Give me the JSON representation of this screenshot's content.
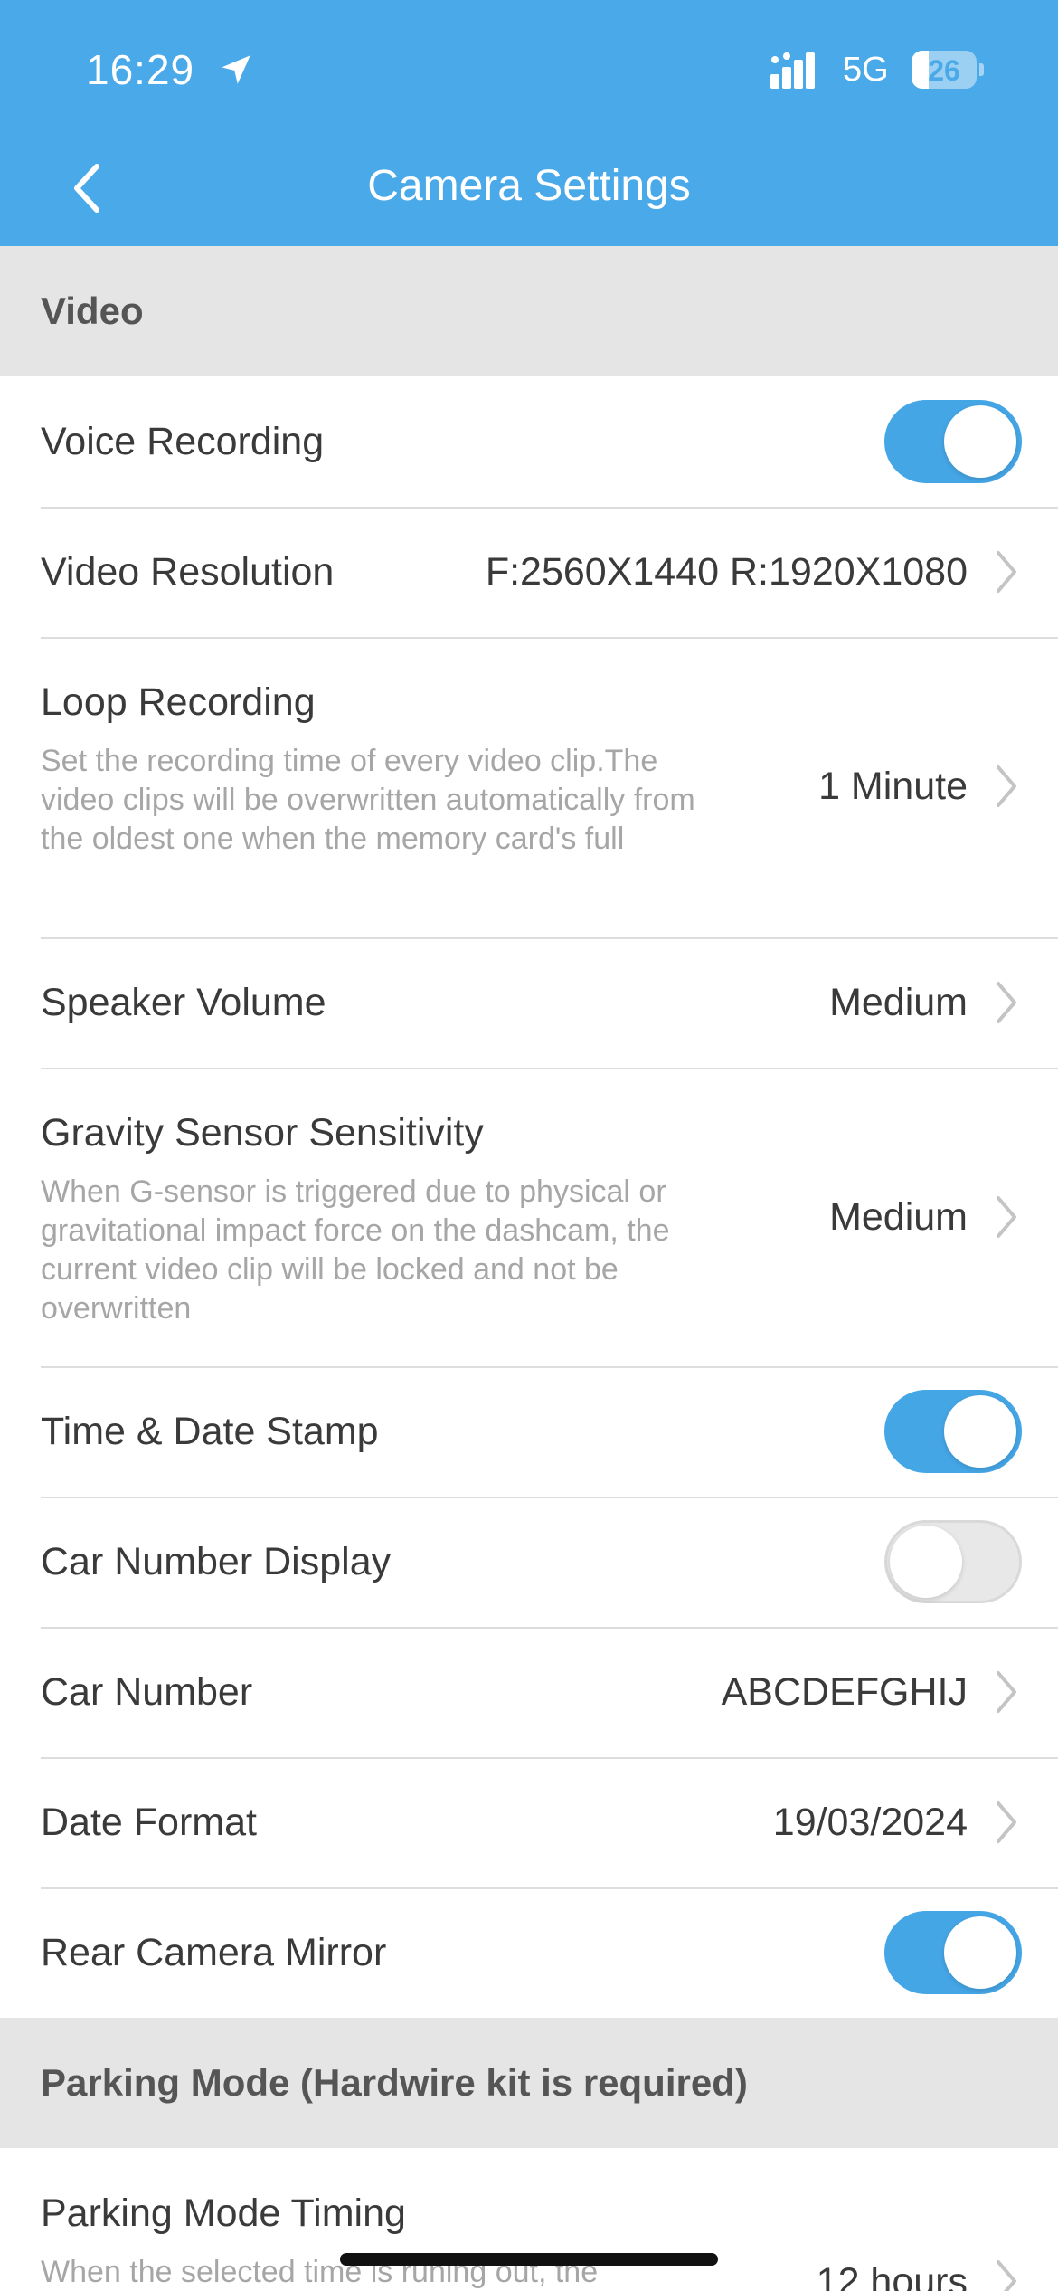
{
  "status_bar": {
    "time": "16:29",
    "network": "5G",
    "battery": "26",
    "battery_level_percent": 26,
    "location_icon": "location-arrow-icon",
    "signal_icon": "signal-bars-icon"
  },
  "nav": {
    "title": "Camera Settings",
    "back_icon": "chevron-left-icon"
  },
  "sections": {
    "video": "Video",
    "parking": "Parking Mode (Hardwire kit is required)"
  },
  "rows": {
    "voice_recording": {
      "label": "Voice Recording",
      "toggle_on": true
    },
    "video_resolution": {
      "label": "Video Resolution",
      "value": "F:2560X1440 R:1920X1080"
    },
    "loop_recording": {
      "label": "Loop Recording",
      "description": "Set the recording time of every video clip.The video clips will be overwritten automatically from the oldest one when the memory card's full",
      "value": "1 Minute"
    },
    "speaker_volume": {
      "label": "Speaker Volume",
      "value": "Medium"
    },
    "gravity_sensor": {
      "label": "Gravity Sensor Sensitivity",
      "description": "When G-sensor is triggered due to physical or gravitational impact force on the dashcam, the current video clip will be locked and not be overwritten",
      "value": "Medium"
    },
    "time_date_stamp": {
      "label": "Time & Date Stamp",
      "toggle_on": true
    },
    "car_number_display": {
      "label": "Car Number Display",
      "toggle_on": false
    },
    "car_number": {
      "label": "Car Number",
      "value": "ABCDEFGHIJ"
    },
    "date_format": {
      "label": "Date Format",
      "value": "19/03/2024"
    },
    "rear_camera_mirror": {
      "label": "Rear Camera Mirror",
      "toggle_on": true
    },
    "parking_mode_timing": {
      "label": "Parking Mode Timing",
      "description": "When the selected time is runing out, the",
      "value": "12 hours"
    }
  },
  "colors": {
    "header": "#4aa9e8",
    "toggle_on": "#45a6e6",
    "section_bg": "#e5e5e5"
  }
}
